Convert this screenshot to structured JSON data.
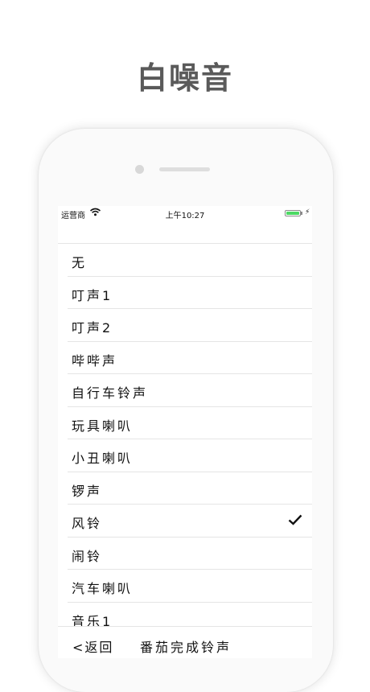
{
  "promo": {
    "title": "白噪音"
  },
  "status_bar": {
    "carrier": "运营商",
    "time": "上午10:27",
    "battery_percent": 100
  },
  "list": {
    "items": [
      {
        "label": "无",
        "selected": false
      },
      {
        "label": "叮声1",
        "selected": false
      },
      {
        "label": "叮声2",
        "selected": false
      },
      {
        "label": "哔哔声",
        "selected": false
      },
      {
        "label": "自行车铃声",
        "selected": false
      },
      {
        "label": "玩具喇叭",
        "selected": false
      },
      {
        "label": "小丑喇叭",
        "selected": false
      },
      {
        "label": "锣声",
        "selected": false
      },
      {
        "label": "风铃",
        "selected": true
      },
      {
        "label": "闹铃",
        "selected": false
      },
      {
        "label": "汽车喇叭",
        "selected": false
      },
      {
        "label": "音乐1",
        "selected": false
      }
    ]
  },
  "nav": {
    "back_label": "<返回",
    "title": "番茄完成铃声"
  },
  "icons": {
    "check": "checkmark-icon",
    "wifi": "wifi-icon",
    "battery": "battery-icon",
    "charging": "bolt-icon"
  },
  "colors": {
    "battery_fill": "#4cd964",
    "promo_text": "#5a5a5a"
  }
}
